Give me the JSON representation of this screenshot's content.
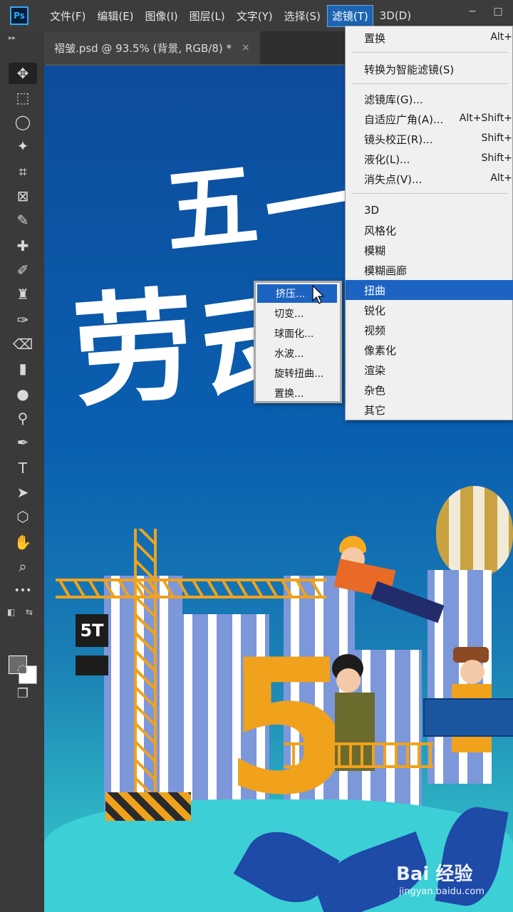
{
  "app": {
    "logo": "Ps"
  },
  "menubar": {
    "items": [
      {
        "label": "文件(F)"
      },
      {
        "label": "编辑(E)"
      },
      {
        "label": "图像(I)"
      },
      {
        "label": "图层(L)"
      },
      {
        "label": "文字(Y)"
      },
      {
        "label": "选择(S)"
      },
      {
        "label": "滤镜(T)",
        "active": true
      },
      {
        "label": "3D(D)"
      }
    ],
    "window_minimize": "−",
    "window_restore": "□"
  },
  "document_tab": {
    "title": "褶皱.psd @ 93.5% (背景, RGB/8) *",
    "close": "×"
  },
  "toolbar": {
    "collapse": "▸▸",
    "tools": [
      {
        "name": "move-tool-icon",
        "glyph": "✥"
      },
      {
        "name": "marquee-tool-icon",
        "glyph": "⬚"
      },
      {
        "name": "lasso-tool-icon",
        "glyph": "◯"
      },
      {
        "name": "magic-wand-tool-icon",
        "glyph": "✦"
      },
      {
        "name": "crop-tool-icon",
        "glyph": "⌗"
      },
      {
        "name": "frame-tool-icon",
        "glyph": "⊠"
      },
      {
        "name": "eyedropper-tool-icon",
        "glyph": "✎"
      },
      {
        "name": "healing-brush-tool-icon",
        "glyph": "✚"
      },
      {
        "name": "brush-tool-icon",
        "glyph": "✐"
      },
      {
        "name": "stamp-tool-icon",
        "glyph": "♜"
      },
      {
        "name": "history-brush-tool-icon",
        "glyph": "✑"
      },
      {
        "name": "eraser-tool-icon",
        "glyph": "⌫"
      },
      {
        "name": "gradient-tool-icon",
        "glyph": "▮"
      },
      {
        "name": "blur-tool-icon",
        "glyph": "●"
      },
      {
        "name": "dodge-tool-icon",
        "glyph": "⚲"
      },
      {
        "name": "pen-tool-icon",
        "glyph": "✒"
      },
      {
        "name": "type-tool-icon",
        "glyph": "T"
      },
      {
        "name": "path-selection-tool-icon",
        "glyph": "➤"
      },
      {
        "name": "shape-tool-icon",
        "glyph": "⬡"
      },
      {
        "name": "hand-tool-icon",
        "glyph": "✋"
      },
      {
        "name": "zoom-tool-icon",
        "glyph": "⌕"
      },
      {
        "name": "more-tools-icon",
        "glyph": "•••"
      }
    ],
    "quick_mask_glyph": "◌",
    "screen_mode_glyph": "❐",
    "swap_glyph": "⇆",
    "default_colors_glyph": "◧",
    "fg_color": "#6b6b6b",
    "bg_color": "#ffffff"
  },
  "filter_menu": {
    "items": [
      {
        "label": "置换",
        "shortcut": "Alt+"
      },
      {
        "label": "转换为智能滤镜(S)",
        "shortcut": ""
      },
      {
        "label": "滤镜库(G)...",
        "shortcut": ""
      },
      {
        "label": "自适应广角(A)...",
        "shortcut": "Alt+Shift+"
      },
      {
        "label": "镜头校正(R)...",
        "shortcut": "Shift+"
      },
      {
        "label": "液化(L)...",
        "shortcut": "Shift+"
      },
      {
        "label": "消失点(V)...",
        "shortcut": "Alt+"
      },
      {
        "label": "3D",
        "shortcut": ""
      },
      {
        "label": "风格化",
        "shortcut": ""
      },
      {
        "label": "模糊",
        "shortcut": ""
      },
      {
        "label": "模糊画廊",
        "shortcut": ""
      },
      {
        "label": "扭曲",
        "shortcut": "",
        "highlight": true
      },
      {
        "label": "锐化",
        "shortcut": ""
      },
      {
        "label": "视频",
        "shortcut": ""
      },
      {
        "label": "像素化",
        "shortcut": ""
      },
      {
        "label": "渲染",
        "shortcut": ""
      },
      {
        "label": "杂色",
        "shortcut": ""
      },
      {
        "label": "其它",
        "shortcut": ""
      }
    ]
  },
  "distort_submenu": {
    "items": [
      {
        "label": "挤压...",
        "highlight": true
      },
      {
        "label": "切变..."
      },
      {
        "label": "球面化..."
      },
      {
        "label": "水波..."
      },
      {
        "label": "旋转扭曲..."
      },
      {
        "label": "置换..."
      }
    ]
  },
  "canvas_art": {
    "headline_chars": [
      "五",
      "一",
      "劳",
      "动"
    ],
    "crane_sign": "5T",
    "big_number": "5"
  },
  "watermark": {
    "brand": "Bai 经验",
    "url": "jingyan.baidu.com"
  },
  "colors": {
    "menu_highlight": "#1c63c2",
    "accent_orange": "#f0a21c",
    "sky_blue": "#0a5fb0"
  }
}
